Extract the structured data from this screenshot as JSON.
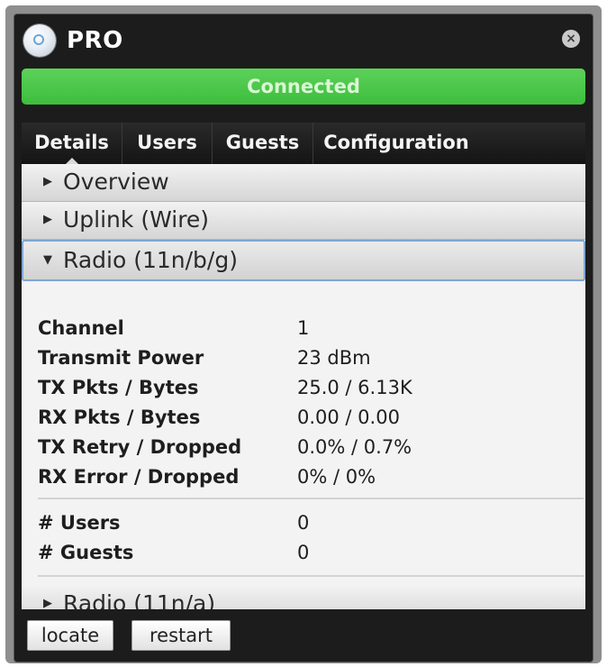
{
  "window": {
    "title": "PRO",
    "app_icon": "circle-logo-icon",
    "close_icon": "close-icon",
    "close_glyph": "×"
  },
  "status": {
    "text": "Connected",
    "color": "#46c044"
  },
  "tabs": [
    {
      "label": "Details",
      "active": true
    },
    {
      "label": "Users",
      "active": false
    },
    {
      "label": "Guests",
      "active": false
    },
    {
      "label": "Configuration",
      "active": false
    }
  ],
  "sections": {
    "overview": {
      "label": "Overview",
      "expanded": false
    },
    "uplink": {
      "label": "Uplink (Wire)",
      "expanded": false
    },
    "radio_bg": {
      "label": "Radio (11n/b/g)",
      "expanded": true
    },
    "radio_a": {
      "label": "Radio (11n/a)",
      "expanded": false
    }
  },
  "arrows": {
    "collapsed": "▶",
    "expanded": "▼"
  },
  "radio_details": [
    {
      "key": "Channel",
      "value": "1"
    },
    {
      "key": "Transmit Power",
      "value": "23 dBm"
    },
    {
      "key": "TX Pkts / Bytes",
      "value": "25.0 / 6.13K"
    },
    {
      "key": "RX Pkts / Bytes",
      "value": "0.00 / 0.00"
    },
    {
      "key": "TX Retry / Dropped",
      "value": "0.0% / 0.7%"
    },
    {
      "key": "RX Error / Dropped",
      "value": "0% / 0%"
    }
  ],
  "radio_counts": [
    {
      "key": "# Users",
      "value": "0"
    },
    {
      "key": "# Guests",
      "value": "0"
    }
  ],
  "buttons": {
    "locate": "locate",
    "restart": "restart"
  }
}
